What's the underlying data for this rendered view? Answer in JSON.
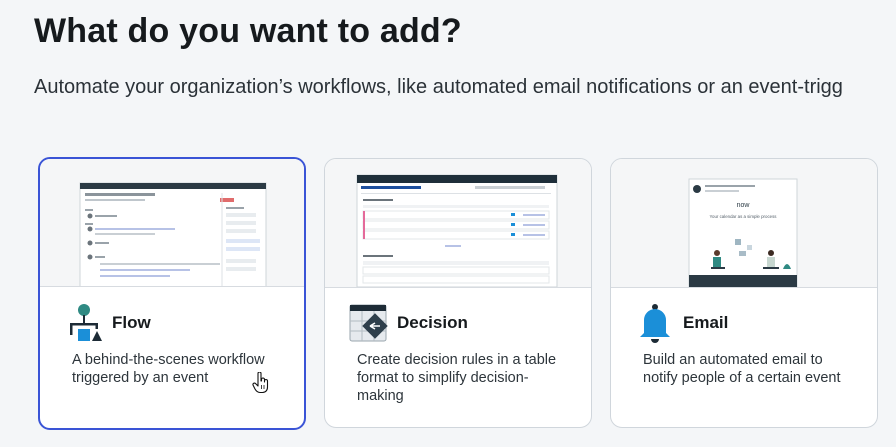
{
  "header": {
    "title": "What do you want to add?",
    "subtitle": "Automate your organization’s workflows, like automated email notifications or an event-trigg"
  },
  "cards": [
    {
      "id": "flow",
      "title": "Flow",
      "description": "A behind-the-scenes workflow triggered by an event",
      "icon": "flow-icon",
      "selected": true
    },
    {
      "id": "decision",
      "title": "Decision",
      "description": "Create decision rules in a table format to simplify decision-making",
      "icon": "decision-table-icon",
      "selected": false
    },
    {
      "id": "email",
      "title": "Email",
      "description": "Build an automated email to notify people of a certain event",
      "icon": "bell-icon",
      "selected": false
    }
  ],
  "previews": {
    "email_brand": "now",
    "email_heading": "Your calendar as a simple process"
  },
  "colors": {
    "accent": "#3a54d6",
    "icon_teal": "#2f8a83",
    "icon_blue": "#1b8fd8",
    "icon_dark": "#1d2b36"
  }
}
